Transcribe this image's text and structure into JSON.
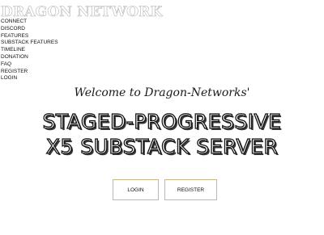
{
  "header": {
    "logo_text": "DRAGON NETWORK"
  },
  "nav": {
    "items": [
      {
        "label": "CONNECT"
      },
      {
        "label": "DISCORD"
      },
      {
        "label": "FEATURES"
      },
      {
        "label": "SUBSTACK FEATURES"
      },
      {
        "label": "TIMELINE"
      },
      {
        "label": "DONATION"
      },
      {
        "label": "FAQ"
      },
      {
        "label": "REGISTER"
      },
      {
        "label": "LOGIN"
      }
    ]
  },
  "hero": {
    "welcome": "Welcome to Dragon-Networks'",
    "headline_line1": "STAGED-PROGRESSIVE",
    "headline_line2": "X5 SUBSTACK SERVER",
    "login_button": "LOGIN",
    "register_button": "REGISTER"
  },
  "colors": {
    "background": "#ffffff",
    "text": "#111111",
    "button_border": "#c9b98a",
    "logo_outline": "#b5b5b5"
  }
}
